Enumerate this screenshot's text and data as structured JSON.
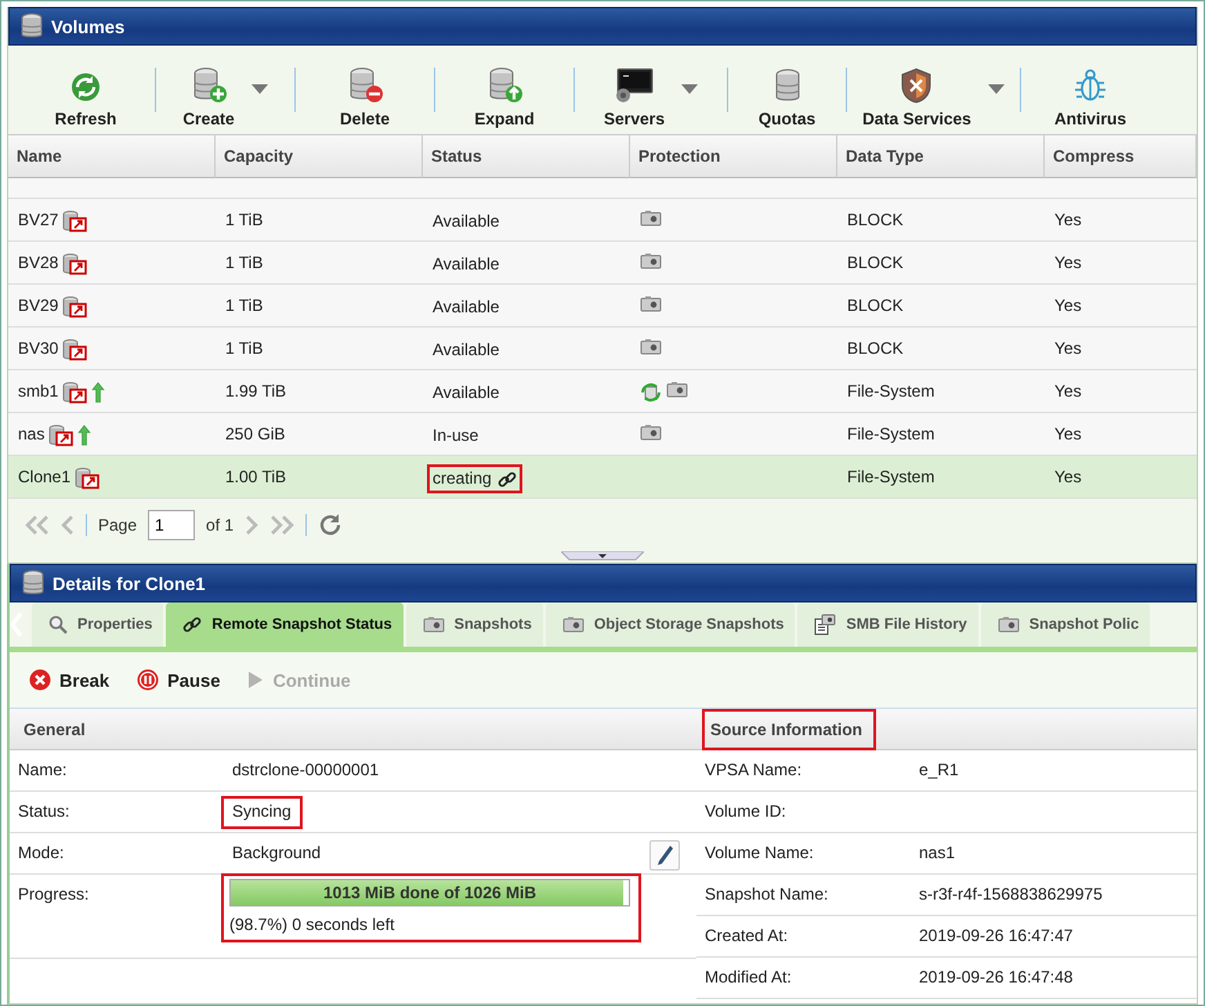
{
  "volumes_panel": {
    "title": "Volumes",
    "toolbar": [
      {
        "label": "Refresh",
        "kind": "refresh",
        "dropdown": false
      },
      {
        "label": "Create",
        "kind": "create",
        "dropdown": true
      },
      {
        "label": "Delete",
        "kind": "delete",
        "dropdown": false
      },
      {
        "label": "Expand",
        "kind": "expand",
        "dropdown": false
      },
      {
        "label": "Servers",
        "kind": "servers",
        "dropdown": true
      },
      {
        "label": "Quotas",
        "kind": "quotas",
        "dropdown": false
      },
      {
        "label": "Data Services",
        "kind": "services",
        "dropdown": true
      },
      {
        "label": "Antivirus",
        "kind": "antivirus",
        "dropdown": false
      }
    ],
    "table": {
      "columns": [
        "Name",
        "Capacity",
        "Status",
        "Protection",
        "Data Type",
        "Compress"
      ],
      "rows": [
        {
          "name": "BV27",
          "capacity": "1 TiB",
          "status": "Available",
          "status_link": false,
          "highlighted": false,
          "snapshot": true,
          "sync": false,
          "data_type": "BLOCK",
          "compress": "Yes",
          "arrow": false,
          "selected": false
        },
        {
          "name": "BV28",
          "capacity": "1 TiB",
          "status": "Available",
          "status_link": false,
          "highlighted": false,
          "snapshot": true,
          "sync": false,
          "data_type": "BLOCK",
          "compress": "Yes",
          "arrow": false,
          "selected": false
        },
        {
          "name": "BV29",
          "capacity": "1 TiB",
          "status": "Available",
          "status_link": false,
          "highlighted": false,
          "snapshot": true,
          "sync": false,
          "data_type": "BLOCK",
          "compress": "Yes",
          "arrow": false,
          "selected": false
        },
        {
          "name": "BV30",
          "capacity": "1 TiB",
          "status": "Available",
          "status_link": false,
          "highlighted": false,
          "snapshot": true,
          "sync": false,
          "data_type": "BLOCK",
          "compress": "Yes",
          "arrow": false,
          "selected": false
        },
        {
          "name": "smb1",
          "capacity": "1.99 TiB",
          "status": "Available",
          "status_link": false,
          "highlighted": false,
          "snapshot": true,
          "sync": true,
          "data_type": "File-System",
          "compress": "Yes",
          "arrow": true,
          "selected": false
        },
        {
          "name": "nas",
          "capacity": "250 GiB",
          "status": "In-use",
          "status_link": false,
          "highlighted": false,
          "snapshot": true,
          "sync": false,
          "data_type": "File-System",
          "compress": "Yes",
          "arrow": true,
          "selected": false
        },
        {
          "name": "Clone1",
          "capacity": "1.00 TiB",
          "status": "creating",
          "status_link": true,
          "highlighted": true,
          "snapshot": false,
          "sync": false,
          "data_type": "File-System",
          "compress": "Yes",
          "arrow": false,
          "selected": true
        }
      ]
    },
    "pager": {
      "page_label": "Page",
      "page": "1",
      "of": "of 1"
    }
  },
  "details_panel": {
    "title": "Details for Clone1",
    "tabs": [
      {
        "label": "Properties",
        "kind": "search",
        "selected": false
      },
      {
        "label": "Remote Snapshot Status",
        "kind": "link",
        "selected": true
      },
      {
        "label": "Snapshots",
        "kind": "camera",
        "selected": false
      },
      {
        "label": "Object Storage Snapshots",
        "kind": "camera",
        "selected": false
      },
      {
        "label": "SMB File History",
        "kind": "document",
        "selected": false
      },
      {
        "label": "Snapshot Polic",
        "kind": "camera",
        "selected": false
      }
    ],
    "actions": [
      {
        "label": "Break",
        "kind": "break",
        "disabled": false
      },
      {
        "label": "Pause",
        "kind": "pause",
        "disabled": false
      },
      {
        "label": "Continue",
        "kind": "continue",
        "disabled": true
      }
    ],
    "general": {
      "heading": "General",
      "heading_highlighted": false,
      "fields": [
        {
          "label": "Name:",
          "value": "dstrclone-00000001",
          "kind": "text",
          "highlighted": false
        },
        {
          "label": "Status:",
          "value": "Syncing",
          "kind": "text",
          "highlighted": true
        },
        {
          "label": "Mode:",
          "value": "Background",
          "kind": "editable",
          "highlighted": false
        },
        {
          "label": "Progress:",
          "kind": "progress",
          "bar_text": "1013 MiB done of 1026 MiB",
          "level": 0.987,
          "note": "(98.7%) 0 seconds left",
          "highlighted": true
        }
      ]
    },
    "source": {
      "heading": "Source Information",
      "heading_highlighted": true,
      "fields": [
        {
          "label": "VPSA Name:",
          "value": "e_R1"
        },
        {
          "label": "Volume ID:"
        },
        {
          "label": "Volume Name:",
          "value": "nas1"
        },
        {
          "label": "Snapshot Name:",
          "value": "s-r3f-r4f-1568838629975"
        },
        {
          "label": "Created At:",
          "value": "2019-09-26 16:47:47"
        },
        {
          "label": "Modified At:",
          "value": "2019-09-26 16:47:48"
        }
      ]
    }
  }
}
